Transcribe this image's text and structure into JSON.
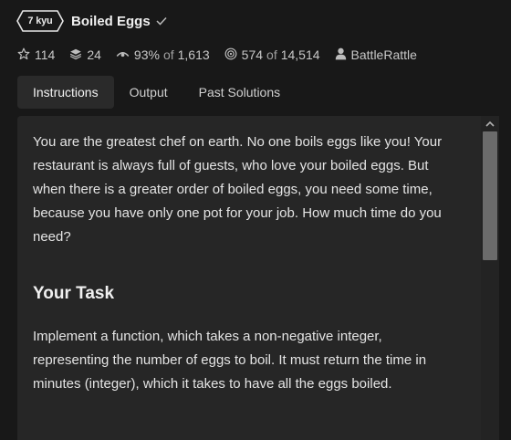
{
  "kata": {
    "rank": "7 kyu",
    "title": "Boiled Eggs",
    "icons": {
      "check": "check-icon",
      "star": "star-icon",
      "collections": "layers-icon",
      "satisfaction": "eye-arc-icon",
      "completions": "target-icon",
      "author": "user-icon"
    }
  },
  "stats": {
    "stars": "114",
    "collections": "24",
    "satisfaction_pct": "93%",
    "of_word": "of",
    "satisfaction_votes": "1,613",
    "completions": "574",
    "attempts": "14,514",
    "author": "BattleRattle"
  },
  "tabs": [
    {
      "label": "Instructions",
      "active": true
    },
    {
      "label": "Output",
      "active": false
    },
    {
      "label": "Past Solutions",
      "active": false
    }
  ],
  "instructions": {
    "intro": "You are the greatest chef on earth. No one boils eggs like you! Your restaurant is always full of guests, who love your boiled eggs. But when there is a greater order of boiled eggs, you need some time, because you have only one pot for your job. How much time do you need?",
    "task_heading": "Your Task",
    "task_text": "Implement a function, which takes a non-negative integer, representing the number of eggs to boil. It must return the time in minutes (integer), which it takes to have all the eggs boiled."
  },
  "colors": {
    "background": "#181818",
    "panel": "#262626",
    "tab_active": "#2a2a2a",
    "scroll_thumb": "#6b6b6b"
  }
}
